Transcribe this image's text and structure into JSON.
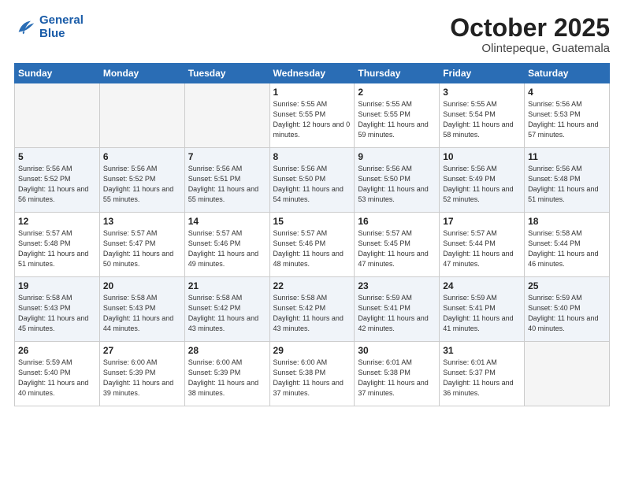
{
  "header": {
    "logo_line1": "General",
    "logo_line2": "Blue",
    "month": "October 2025",
    "location": "Olintepeque, Guatemala"
  },
  "days_of_week": [
    "Sunday",
    "Monday",
    "Tuesday",
    "Wednesday",
    "Thursday",
    "Friday",
    "Saturday"
  ],
  "weeks": [
    [
      {
        "num": "",
        "sunrise": "",
        "sunset": "",
        "daylight": "",
        "empty": true
      },
      {
        "num": "",
        "sunrise": "",
        "sunset": "",
        "daylight": "",
        "empty": true
      },
      {
        "num": "",
        "sunrise": "",
        "sunset": "",
        "daylight": "",
        "empty": true
      },
      {
        "num": "1",
        "sunrise": "5:55 AM",
        "sunset": "5:55 PM",
        "daylight": "12 hours and 0 minutes."
      },
      {
        "num": "2",
        "sunrise": "5:55 AM",
        "sunset": "5:55 PM",
        "daylight": "11 hours and 59 minutes."
      },
      {
        "num": "3",
        "sunrise": "5:55 AM",
        "sunset": "5:54 PM",
        "daylight": "11 hours and 58 minutes."
      },
      {
        "num": "4",
        "sunrise": "5:56 AM",
        "sunset": "5:53 PM",
        "daylight": "11 hours and 57 minutes."
      }
    ],
    [
      {
        "num": "5",
        "sunrise": "5:56 AM",
        "sunset": "5:52 PM",
        "daylight": "11 hours and 56 minutes."
      },
      {
        "num": "6",
        "sunrise": "5:56 AM",
        "sunset": "5:52 PM",
        "daylight": "11 hours and 55 minutes."
      },
      {
        "num": "7",
        "sunrise": "5:56 AM",
        "sunset": "5:51 PM",
        "daylight": "11 hours and 55 minutes."
      },
      {
        "num": "8",
        "sunrise": "5:56 AM",
        "sunset": "5:50 PM",
        "daylight": "11 hours and 54 minutes."
      },
      {
        "num": "9",
        "sunrise": "5:56 AM",
        "sunset": "5:50 PM",
        "daylight": "11 hours and 53 minutes."
      },
      {
        "num": "10",
        "sunrise": "5:56 AM",
        "sunset": "5:49 PM",
        "daylight": "11 hours and 52 minutes."
      },
      {
        "num": "11",
        "sunrise": "5:56 AM",
        "sunset": "5:48 PM",
        "daylight": "11 hours and 51 minutes."
      }
    ],
    [
      {
        "num": "12",
        "sunrise": "5:57 AM",
        "sunset": "5:48 PM",
        "daylight": "11 hours and 51 minutes."
      },
      {
        "num": "13",
        "sunrise": "5:57 AM",
        "sunset": "5:47 PM",
        "daylight": "11 hours and 50 minutes."
      },
      {
        "num": "14",
        "sunrise": "5:57 AM",
        "sunset": "5:46 PM",
        "daylight": "11 hours and 49 minutes."
      },
      {
        "num": "15",
        "sunrise": "5:57 AM",
        "sunset": "5:46 PM",
        "daylight": "11 hours and 48 minutes."
      },
      {
        "num": "16",
        "sunrise": "5:57 AM",
        "sunset": "5:45 PM",
        "daylight": "11 hours and 47 minutes."
      },
      {
        "num": "17",
        "sunrise": "5:57 AM",
        "sunset": "5:44 PM",
        "daylight": "11 hours and 47 minutes."
      },
      {
        "num": "18",
        "sunrise": "5:58 AM",
        "sunset": "5:44 PM",
        "daylight": "11 hours and 46 minutes."
      }
    ],
    [
      {
        "num": "19",
        "sunrise": "5:58 AM",
        "sunset": "5:43 PM",
        "daylight": "11 hours and 45 minutes."
      },
      {
        "num": "20",
        "sunrise": "5:58 AM",
        "sunset": "5:43 PM",
        "daylight": "11 hours and 44 minutes."
      },
      {
        "num": "21",
        "sunrise": "5:58 AM",
        "sunset": "5:42 PM",
        "daylight": "11 hours and 43 minutes."
      },
      {
        "num": "22",
        "sunrise": "5:58 AM",
        "sunset": "5:42 PM",
        "daylight": "11 hours and 43 minutes."
      },
      {
        "num": "23",
        "sunrise": "5:59 AM",
        "sunset": "5:41 PM",
        "daylight": "11 hours and 42 minutes."
      },
      {
        "num": "24",
        "sunrise": "5:59 AM",
        "sunset": "5:41 PM",
        "daylight": "11 hours and 41 minutes."
      },
      {
        "num": "25",
        "sunrise": "5:59 AM",
        "sunset": "5:40 PM",
        "daylight": "11 hours and 40 minutes."
      }
    ],
    [
      {
        "num": "26",
        "sunrise": "5:59 AM",
        "sunset": "5:40 PM",
        "daylight": "11 hours and 40 minutes."
      },
      {
        "num": "27",
        "sunrise": "6:00 AM",
        "sunset": "5:39 PM",
        "daylight": "11 hours and 39 minutes."
      },
      {
        "num": "28",
        "sunrise": "6:00 AM",
        "sunset": "5:39 PM",
        "daylight": "11 hours and 38 minutes."
      },
      {
        "num": "29",
        "sunrise": "6:00 AM",
        "sunset": "5:38 PM",
        "daylight": "11 hours and 37 minutes."
      },
      {
        "num": "30",
        "sunrise": "6:01 AM",
        "sunset": "5:38 PM",
        "daylight": "11 hours and 37 minutes."
      },
      {
        "num": "31",
        "sunrise": "6:01 AM",
        "sunset": "5:37 PM",
        "daylight": "11 hours and 36 minutes."
      },
      {
        "num": "",
        "sunrise": "",
        "sunset": "",
        "daylight": "",
        "empty": true
      }
    ]
  ]
}
